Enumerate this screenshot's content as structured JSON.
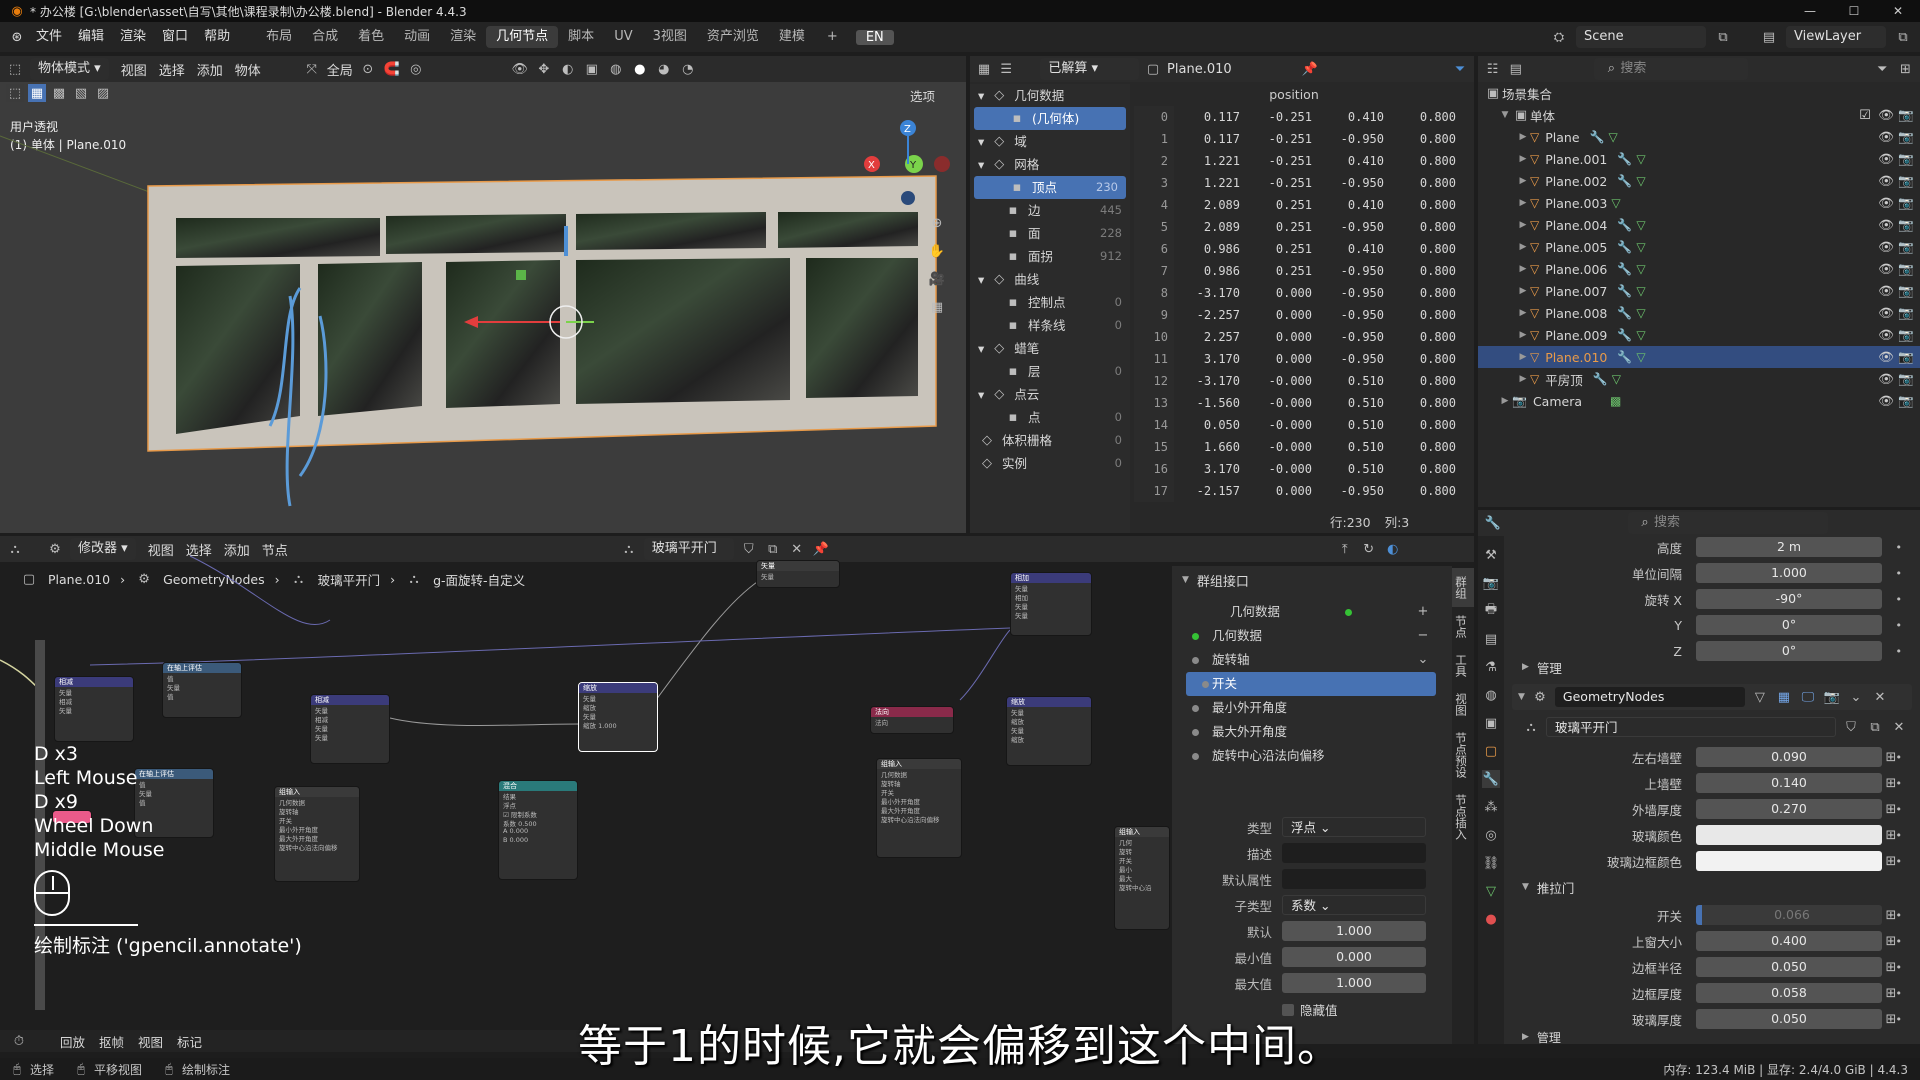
{
  "window": {
    "title": "* 办公楼 [G:\\blender\\asset\\自写\\其他\\课程录制\\办公楼.blend] - Blender 4.4.3"
  },
  "menu": [
    "文件",
    "编辑",
    "渲染",
    "窗口",
    "帮助"
  ],
  "workspaces": [
    "布局",
    "合成",
    "着色",
    "动画",
    "渲染",
    "几何节点",
    "脚本",
    "UV",
    "3视图",
    "资产浏览",
    "建模"
  ],
  "active_workspace": "几何节点",
  "lang_badge": "EN",
  "scene": {
    "label": "Scene",
    "viewlayer": "ViewLayer"
  },
  "viewport": {
    "mode": "物体模式",
    "menus": [
      "视图",
      "选择",
      "添加",
      "物体"
    ],
    "orientation": "全局",
    "options": "选项",
    "overlay_title": "用户透视",
    "overlay_sub": "(1) 单体 | Plane.010"
  },
  "spreadsheet": {
    "eval_label": "已解算",
    "object": "Plane.010",
    "column": "position",
    "tree": [
      {
        "label": "几何数据",
        "count": "",
        "level": 0,
        "head": true
      },
      {
        "label": "(几何体)",
        "count": "",
        "level": 1,
        "sel": true
      },
      {
        "label": "域",
        "count": "",
        "level": 0,
        "head": true
      },
      {
        "label": "网格",
        "count": "",
        "level": 0,
        "head": true
      },
      {
        "label": "顶点",
        "count": "230",
        "level": 1,
        "sel": true
      },
      {
        "label": "边",
        "count": "445",
        "level": 1
      },
      {
        "label": "面",
        "count": "228",
        "level": 1
      },
      {
        "label": "面拐",
        "count": "912",
        "level": 1
      },
      {
        "label": "曲线",
        "count": "",
        "level": 0,
        "head": true
      },
      {
        "label": "控制点",
        "count": "0",
        "level": 1
      },
      {
        "label": "样条线",
        "count": "0",
        "level": 1
      },
      {
        "label": "蜡笔",
        "count": "",
        "level": 0,
        "head": true
      },
      {
        "label": "层",
        "count": "0",
        "level": 1
      },
      {
        "label": "点云",
        "count": "",
        "level": 0,
        "head": true
      },
      {
        "label": "点",
        "count": "0",
        "level": 1
      },
      {
        "label": "体积栅格",
        "count": "0",
        "level": 0
      },
      {
        "label": "实例",
        "count": "0",
        "level": 0
      }
    ],
    "rows": [
      [
        "0",
        "0.117",
        "-0.251",
        "0.410",
        "0.800"
      ],
      [
        "1",
        "0.117",
        "-0.251",
        "-0.950",
        "0.800"
      ],
      [
        "2",
        "1.221",
        "-0.251",
        "0.410",
        "0.800"
      ],
      [
        "3",
        "1.221",
        "-0.251",
        "-0.950",
        "0.800"
      ],
      [
        "4",
        "2.089",
        "0.251",
        "0.410",
        "0.800"
      ],
      [
        "5",
        "2.089",
        "0.251",
        "-0.950",
        "0.800"
      ],
      [
        "6",
        "0.986",
        "0.251",
        "0.410",
        "0.800"
      ],
      [
        "7",
        "0.986",
        "0.251",
        "-0.950",
        "0.800"
      ],
      [
        "8",
        "-3.170",
        "0.000",
        "-0.950",
        "0.800"
      ],
      [
        "9",
        "-2.257",
        "0.000",
        "-0.950",
        "0.800"
      ],
      [
        "10",
        "2.257",
        "0.000",
        "-0.950",
        "0.800"
      ],
      [
        "11",
        "3.170",
        "0.000",
        "-0.950",
        "0.800"
      ],
      [
        "12",
        "-3.170",
        "-0.000",
        "0.510",
        "0.800"
      ],
      [
        "13",
        "-1.560",
        "-0.000",
        "0.510",
        "0.800"
      ],
      [
        "14",
        "0.050",
        "-0.000",
        "0.510",
        "0.800"
      ],
      [
        "15",
        "1.660",
        "-0.000",
        "0.510",
        "0.800"
      ],
      [
        "16",
        "3.170",
        "-0.000",
        "0.510",
        "0.800"
      ],
      [
        "17",
        "-2.157",
        "0.000",
        "-0.950",
        "0.800"
      ]
    ],
    "footer_rows": "行:230",
    "footer_cols": "列:3"
  },
  "outliner": {
    "search_placeholder": "搜索",
    "collection": "场景集合",
    "group": "单体",
    "items": [
      {
        "name": "Plane",
        "sel": false,
        "mod": true
      },
      {
        "name": "Plane.001",
        "sel": false,
        "mod": true
      },
      {
        "name": "Plane.002",
        "sel": false,
        "mod": true
      },
      {
        "name": "Plane.003",
        "sel": false,
        "mod": false
      },
      {
        "name": "Plane.004",
        "sel": false,
        "mod": true
      },
      {
        "name": "Plane.005",
        "sel": false,
        "mod": true
      },
      {
        "name": "Plane.006",
        "sel": false,
        "mod": true
      },
      {
        "name": "Plane.007",
        "sel": false,
        "mod": true
      },
      {
        "name": "Plane.008",
        "sel": false,
        "mod": true
      },
      {
        "name": "Plane.009",
        "sel": false,
        "mod": true
      },
      {
        "name": "Plane.010",
        "sel": true,
        "mod": true
      },
      {
        "name": "平房顶",
        "sel": false,
        "mod": true
      }
    ],
    "camera": "Camera"
  },
  "node_editor": {
    "editor_label": "修改器",
    "menus": [
      "视图",
      "选择",
      "添加",
      "节点"
    ],
    "group_name": "玻璃平开门",
    "breadcrumb": [
      "Plane.010",
      "GeometryNodes",
      "玻璃平开门",
      "g-面旋转-自定义"
    ]
  },
  "group_interface": {
    "title": "群组接口",
    "sockets": [
      "几何数据",
      "几何数据",
      "旋转轴",
      "开关",
      "最小外开角度",
      "最大外开角度",
      "旋转中心沿法向偏移"
    ],
    "selected": "开关",
    "props": [
      {
        "label": "类型",
        "value": "浮点",
        "dropdown": true
      },
      {
        "label": "描述",
        "value": "",
        "dark": true
      },
      {
        "label": "默认属性",
        "value": "",
        "dark": true
      },
      {
        "label": "子类型",
        "value": "系数",
        "dropdown": true
      },
      {
        "label": "默认",
        "value": "1.000"
      },
      {
        "label": "最小值",
        "value": "0.000"
      },
      {
        "label": "最大值",
        "value": "1.000"
      }
    ],
    "hide_value": "隐藏值"
  },
  "node_tabs": [
    "群组",
    "节点",
    "工具",
    "视图",
    "节点预设",
    "节点插入"
  ],
  "keylog": [
    "D x3",
    "Left Mouse",
    "D x9",
    "Wheel Down",
    "Middle Mouse"
  ],
  "operator_hint": "绘制标注 ('gpencil.annotate')",
  "properties": {
    "search_placeholder": "搜索",
    "top_rows": [
      {
        "label": "高度",
        "value": "2 m"
      },
      {
        "label": "单位间隔",
        "value": "1.000"
      },
      {
        "label": "旋转 X",
        "value": "-90°"
      },
      {
        "label": "Y",
        "value": "0°"
      },
      {
        "label": "Z",
        "value": "0°"
      }
    ],
    "manage_label": "管理",
    "modifier_name": "GeometryNodes",
    "node_group": "玻璃平开门",
    "mod_rows": [
      {
        "label": "左右墙壁",
        "value": "0.090"
      },
      {
        "label": "上墙壁",
        "value": "0.140"
      },
      {
        "label": "外墙厚度",
        "value": "0.270"
      },
      {
        "label": "玻璃颜色",
        "value": "",
        "color": "#e8e8e8"
      },
      {
        "label": "玻璃边框颜色",
        "value": "",
        "color": "#f2f2f2"
      }
    ],
    "sub_panel": "推拉门",
    "sub_rows": [
      {
        "label": "开关",
        "value": "0.066",
        "disabled": true
      },
      {
        "label": "上窗大小",
        "value": "0.400"
      },
      {
        "label": "边框半径",
        "value": "0.050"
      },
      {
        "label": "边框厚度",
        "value": "0.058"
      },
      {
        "label": "玻璃厚度",
        "value": "0.050"
      }
    ],
    "bottom_label": "管理"
  },
  "timeline": {
    "menus": [
      "回放",
      "抠帧",
      "视图",
      "标记"
    ]
  },
  "status": {
    "items": [
      "选择",
      "平移视图",
      "绘制标注"
    ],
    "memory": "内存: 123.4 MiB | 显存: 2.4/4.0 GiB | 4.4.3"
  },
  "subtitle": "等于1的时候,它就会偏移到这个中间。",
  "colors": {
    "accent": "#4772b3",
    "selected_row": "#334d80",
    "orange": "#e89a49"
  }
}
